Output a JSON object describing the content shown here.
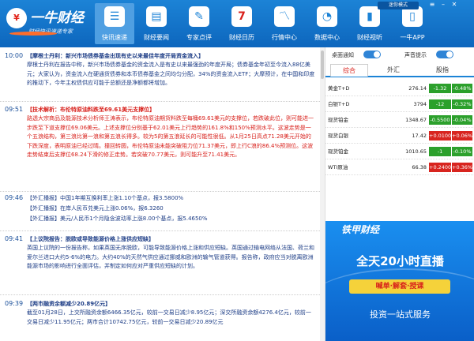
{
  "header": {
    "brand": "一牛财经",
    "slogan": "财经快讯速递专家",
    "skin_button": "迷你模式",
    "nav": [
      {
        "label": "快讯速递",
        "icon": "news-flash-icon"
      },
      {
        "label": "财经要闻",
        "icon": "newspaper-icon"
      },
      {
        "label": "专家点评",
        "icon": "expert-icon"
      },
      {
        "label": "财经日历",
        "icon": "calendar-icon"
      },
      {
        "label": "行情中心",
        "icon": "market-icon"
      },
      {
        "label": "数据中心",
        "icon": "data-icon"
      },
      {
        "label": "财经视听",
        "icon": "video-icon"
      },
      {
        "label": "一牛APP",
        "icon": "phone-icon"
      }
    ]
  },
  "news": [
    {
      "time": "10:00",
      "headline": "【摩根士丹利：新兴市场债券基金出现有史以来最佳年度开局资金流入】",
      "body": "摩根士丹利在报告中称，新兴市场债券基金的资金流入是有史以来最强劲的年度开局；债券基金年初至今流入88亿美元；大家认为，资金流入在硬通货债券和本币债券基金之间均匀分配，34%的资金流入ETF；大摩预计，在中国和印度的推动下，今年主权债供应可能于总额还是净额都将增加。"
    },
    {
      "time": "09:51",
      "headline": "【技术解析：布伦特原油料跌至69.61美元支撑位】",
      "body": "路透大宗商品及能源技术分析师王涛表示，布伦特原油期货料跌至每桶69.61美元的支撑位，若跌破此位，则可能进一步跌至下道支撑位69.06美元。上述支撑位分别基于62.01美元上行趋势的161.8%和150%预测水平。这波走势是一个五浪结构，第三浪比第一浪和第五浪长得多。较为5的第五浪延长的可能性很低。从1月25日高点71.28美元开始的下跌深度，表明原油已经过晴。撞回转圆，布伦特原油未能突破阻力位71.37美元，即上行C浪的86.4%预测位。这波走势结束后支撑位68.24下滑的修正走势。若突破70.77美元，则可能升至71.41美元。"
    },
    {
      "time": "09:46",
      "lines": [
        "【外汇播报】中国1年期互换利率上涨1.10个基点，报3.5800%",
        "【外汇播报】在岸人民币兑美元上涨0.06%，报6.3260",
        "【外汇播报】美元/人民币1个月隐含波动率上涨8.00个基点，报5.4650%"
      ]
    },
    {
      "time": "09:41",
      "headline": "【上议院报告：脱欧或导致能源价格上涨供应短缺】",
      "body": "英国上议院的一份报告称，如果英国无序脱欧，可能导致能源价格上涨和供应短缺。英国通过输电网络从法国、荷兰和爱尔兰进口大约5-6%的电力。大约40%的天然气供应通过挪威和欧洲的输气管道获得。报告称，政府应当对脱离欧洲能源市场的影响进行全面评估，并制定如何应对严重供应短缺的计划。"
    },
    {
      "time": "09:39",
      "headline": "【两市融资余额减少20.89亿元】",
      "body": "截至01月28日，上交所融资余额6466.35亿元，较前一交易日减少8.95亿元；深交所融资余额4276.4亿元，较前一交易日减少11.95亿元；两市合计10742.75亿元，较前一交易日减少20.89亿元"
    }
  ],
  "right": {
    "toggle_desktop": "桌面通知",
    "toggle_sound": "声音提示",
    "tabs": [
      "综合",
      "外汇",
      "股指"
    ],
    "quotes": [
      {
        "name": "黄金T+D",
        "price": "276.14",
        "change": "-1.32",
        "pct": "-0.48%"
      },
      {
        "name": "白银T+D",
        "price": "3794",
        "change": "-12",
        "pct": "-0.32%"
      },
      {
        "name": "现货铂金",
        "price": "1348.67",
        "change": "-0.5500",
        "pct": "-0.04%"
      },
      {
        "name": "现货白银",
        "price": "17.42",
        "change": "+0.0100",
        "pct": "+0.06%"
      },
      {
        "name": "现货铂金",
        "price": "1010.65",
        "change": "-1",
        "pct": "-0.10%"
      },
      {
        "name": "WTI原油",
        "price": "66.38",
        "change": "+0.2400",
        "pct": "+0.36%"
      }
    ],
    "ad": {
      "brand": "铁甲财经",
      "line1": "全天20小时直播",
      "line2": "喊单·解套·授课",
      "line3": "投资一站式服务"
    }
  },
  "colors": {
    "header": "#1c83d6",
    "up": "#d8251f",
    "down": "#2ca02c",
    "headline_red": "#d8201b"
  }
}
